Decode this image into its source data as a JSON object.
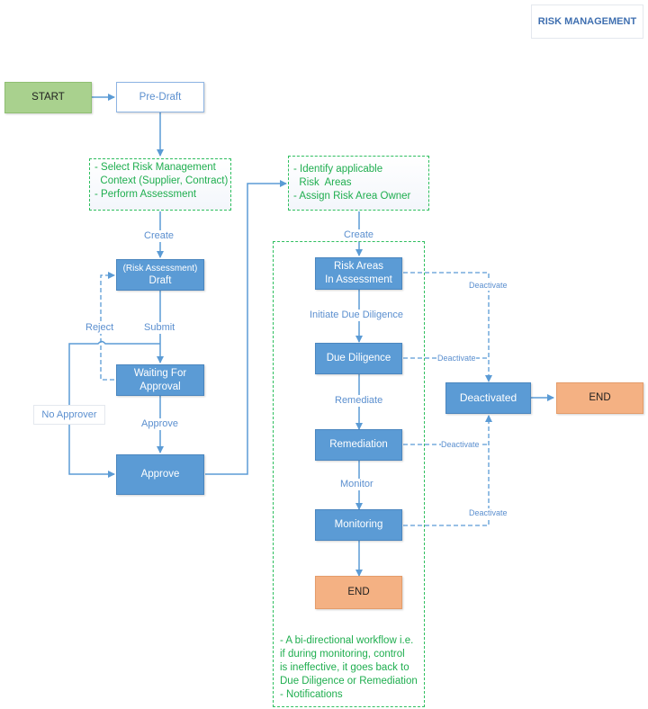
{
  "title": "RISK MANAGEMENT",
  "colors": {
    "state": "#5b9bd5",
    "start": "#a9d18e",
    "end": "#f4b183",
    "note": "#1fae4f",
    "connector": "#5b9bd5"
  },
  "nodes": {
    "start": "START",
    "pre_draft": "Pre-Draft",
    "draft_line1": "(Risk Assessment)",
    "draft_line2": "Draft",
    "waiting": "Waiting For\nApproval",
    "approve": "Approve",
    "risk_areas": "Risk Areas\nIn Assessment",
    "due_diligence": "Due Diligence",
    "remediation": "Remediation",
    "monitoring": "Monitoring",
    "end_main": "END",
    "deactivated": "Deactivated",
    "end_deactivated": "END"
  },
  "notes": {
    "assessment": "- Select Risk Management\n  Context (Supplier, Contract)\n- Perform Assessment",
    "risk_areas": "- Identify applicable\n  Risk  Areas\n- Assign Risk Area Owner",
    "workflow": "- A bi-directional workflow i.e.\nif during monitoring, control\nis ineffective, it goes back to\nDue Diligence or Remediation\n- Notifications"
  },
  "edge_labels": {
    "create_1": "Create",
    "submit": "Submit",
    "reject": "Reject",
    "approve": "Approve",
    "no_approver": "No Approver",
    "create_2": "Create",
    "initiate_dd": "Initiate Due Diligence",
    "remediate": "Remediate",
    "monitor": "Monitor",
    "deactivate_1": "Deactivate",
    "deactivate_2": "Deactivate",
    "deactivate_3": "Deactivate",
    "deactivate_4": "Deactivate"
  }
}
